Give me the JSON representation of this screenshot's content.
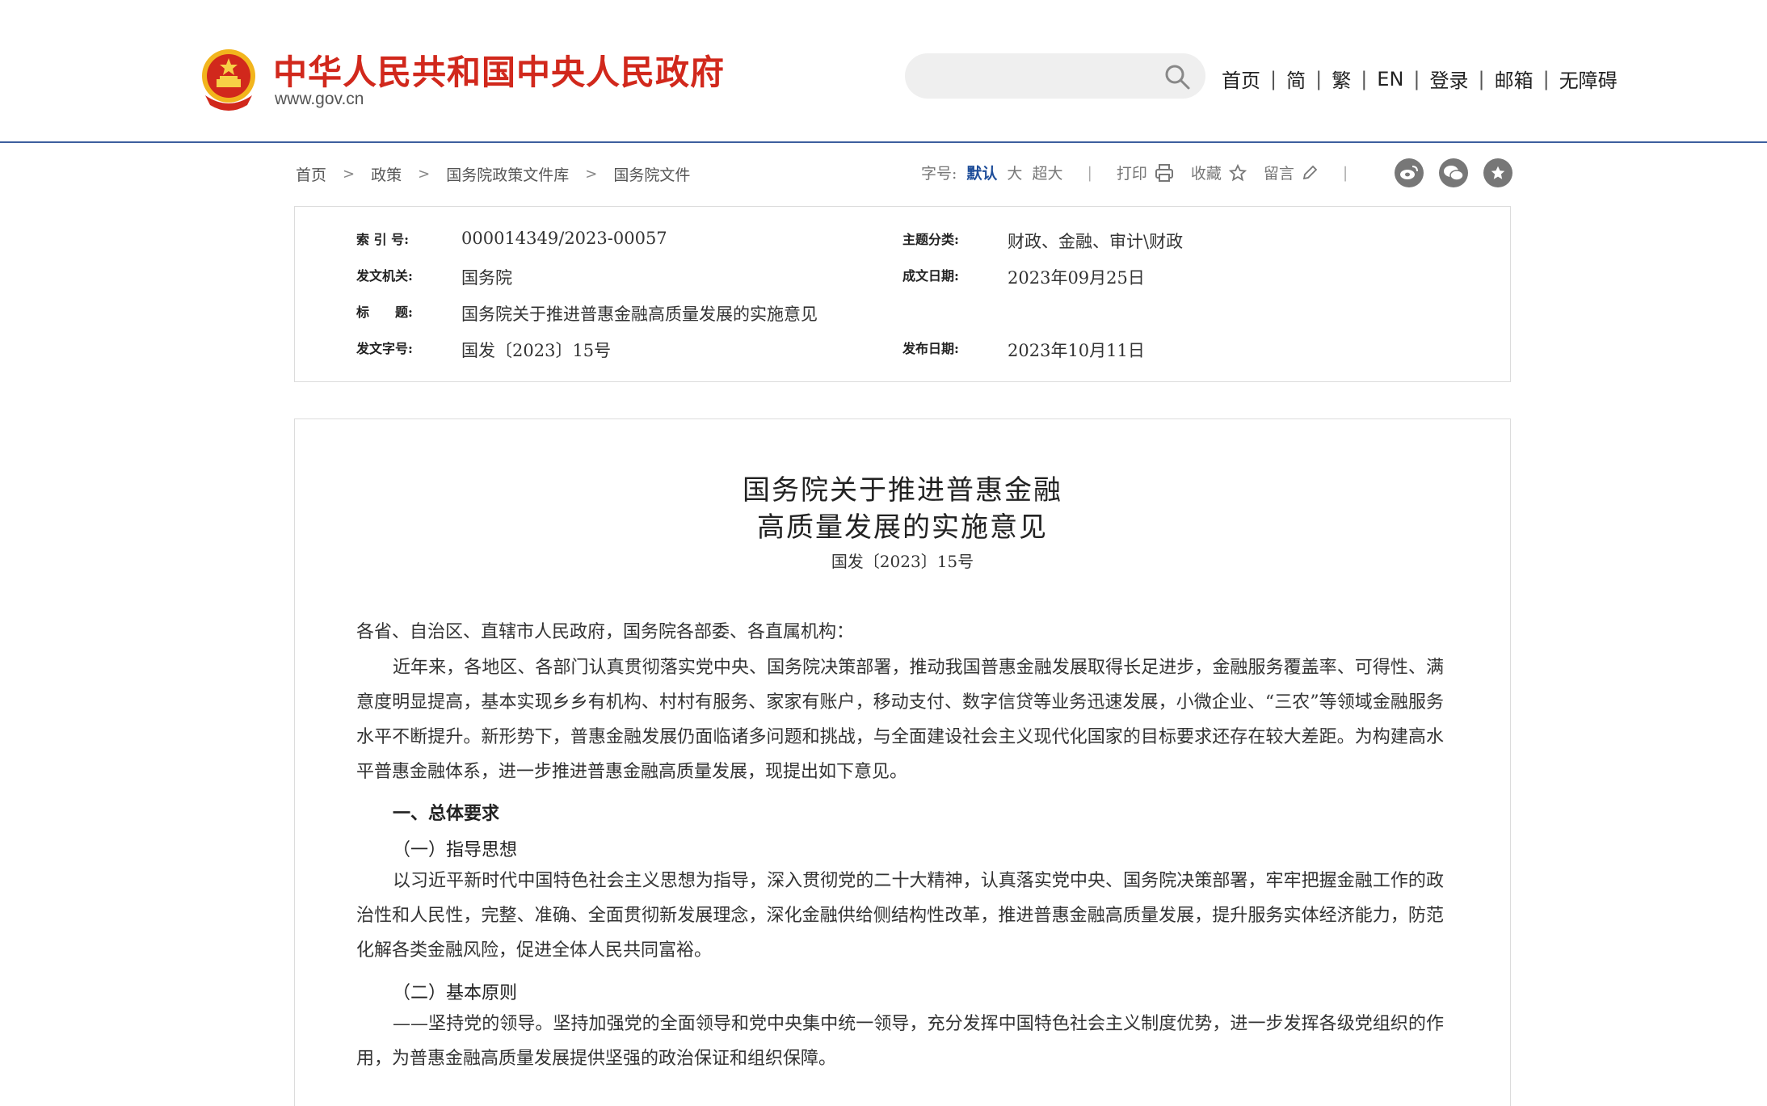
{
  "header": {
    "site_title": "中华人民共和国中央人民政府",
    "site_url": "www.gov.cn",
    "search_placeholder": "",
    "nav": [
      "首页",
      "简",
      "繁",
      "EN",
      "登录",
      "邮箱",
      "无障碍"
    ],
    "brand_color": "#d1281c",
    "divider_color": "#3d5f9e"
  },
  "breadcrumb": [
    "首页",
    "政策",
    "国务院政策文件库",
    "国务院文件"
  ],
  "toolbar": {
    "font_label": "字号:",
    "font_sizes": [
      "默认",
      "大",
      "超大"
    ],
    "print_label": "打印",
    "favorite_label": "收藏",
    "comment_label": "留言",
    "share_icons": [
      "weibo-icon",
      "wechat-icon",
      "star-icon"
    ]
  },
  "info": {
    "index_label": "索 引 号:",
    "index_value": "000014349/2023-00057",
    "topic_label": "主题分类:",
    "topic_value": "财政、金融、审计\\财政",
    "issuer_label": "发文机关:",
    "issuer_value": "国务院",
    "created_label": "成文日期:",
    "created_value": "2023年09月25日",
    "title_label": "标　　题:",
    "title_value": "国务院关于推进普惠金融高质量发展的实施意见",
    "docno_label": "发文字号:",
    "docno_value": "国发〔2023〕15号",
    "published_label": "发布日期:",
    "published_value": "2023年10月11日"
  },
  "article": {
    "title_line1": "国务院关于推进普惠金融",
    "title_line2": "高质量发展的实施意见",
    "doc_no": "国发〔2023〕15号",
    "salutation": "各省、自治区、直辖市人民政府，国务院各部委、各直属机构：",
    "para1": "近年来，各地区、各部门认真贯彻落实党中央、国务院决策部署，推动我国普惠金融发展取得长足进步，金融服务覆盖率、可得性、满意度明显提高，基本实现乡乡有机构、村村有服务、家家有账户，移动支付、数字信贷等业务迅速发展，小微企业、“三农”等领域金融服务水平不断提升。新形势下，普惠金融发展仍面临诸多问题和挑战，与全面建设社会主义现代化国家的目标要求还存在较大差距。为构建高水平普惠金融体系，进一步推进普惠金融高质量发展，现提出如下意见。",
    "section1": "一、总体要求",
    "sub1": "（一）指导思想",
    "para2": "以习近平新时代中国特色社会主义思想为指导，深入贯彻党的二十大精神，认真落实党中央、国务院决策部署，牢牢把握金融工作的政治性和人民性，完整、准确、全面贯彻新发展理念，深化金融供给侧结构性改革，推进普惠金融高质量发展，提升服务实体经济能力，防范化解各类金融风险，促进全体人民共同富裕。",
    "sub2": "（二）基本原则",
    "para3": "——坚持党的领导。坚持加强党的全面领导和党中央集中统一领导，充分发挥中国特色社会主义制度优势，进一步发挥各级党组织的作用，为普惠金融高质量发展提供坚强的政治保证和组织保障。"
  }
}
